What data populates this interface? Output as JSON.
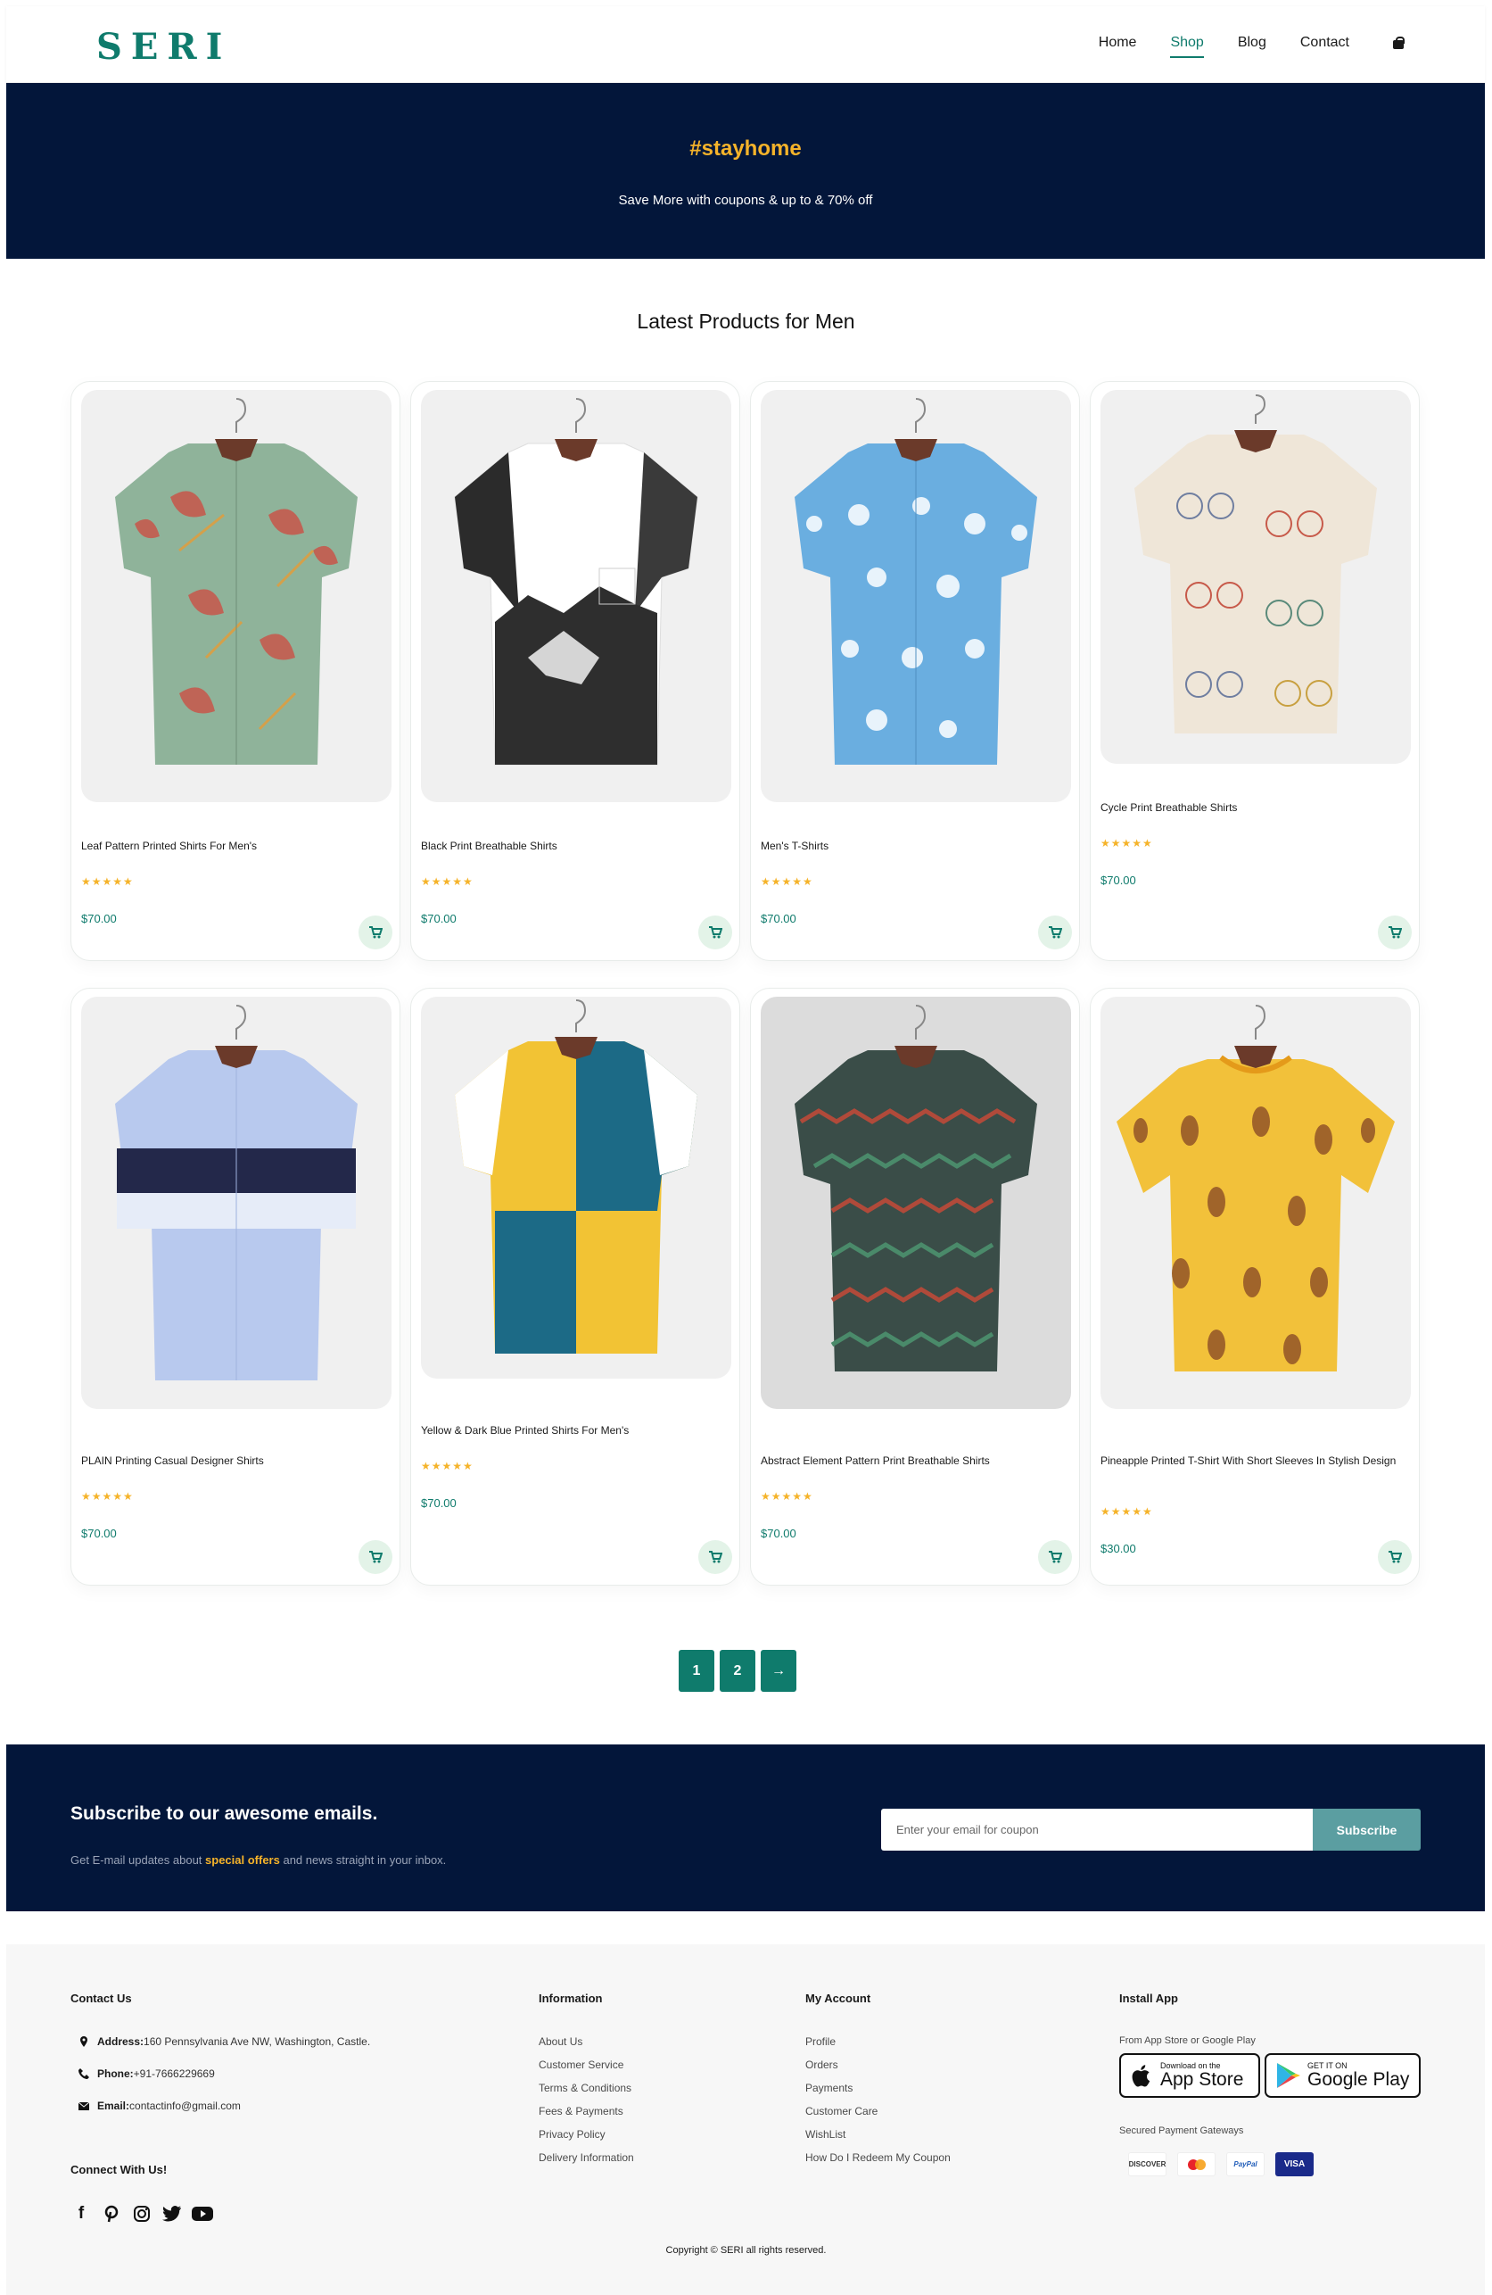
{
  "brand": {
    "logo": "SERI"
  },
  "nav": {
    "items": [
      {
        "label": "Home"
      },
      {
        "label": "Shop"
      },
      {
        "label": "Blog"
      },
      {
        "label": "Contact"
      }
    ],
    "active": "Shop"
  },
  "hero": {
    "tag": "#stayhome",
    "subtitle": "Save More with coupons & up to & 70% off"
  },
  "section_title": "Latest Products for Men",
  "products": [
    {
      "name": "Leaf Pattern Printed Shirts For Men's",
      "stars": "★★★★★",
      "price": "$70.00"
    },
    {
      "name": "Black Print Breathable Shirts",
      "stars": "★★★★★",
      "price": "$70.00"
    },
    {
      "name": "Men's T-Shirts",
      "stars": "★★★★★",
      "price": "$70.00"
    },
    {
      "name": "Cycle Print Breathable Shirts",
      "stars": "★★★★★",
      "price": "$70.00"
    },
    {
      "name": "PLAIN Printing Casual Designer Shirts",
      "stars": "★★★★★",
      "price": "$70.00"
    },
    {
      "name": "Yellow & Dark Blue Printed Shirts For Men's",
      "stars": "★★★★★",
      "price": "$70.00"
    },
    {
      "name": "Abstract Element Pattern Print Breathable Shirts",
      "stars": "★★★★★",
      "price": "$70.00"
    },
    {
      "name": "Pineapple Printed T-Shirt With Short Sleeves In Stylish Design",
      "stars": "★★★★★",
      "price": "$30.00"
    }
  ],
  "pagination": {
    "pages": [
      "1",
      "2"
    ],
    "next": "→"
  },
  "newsletter": {
    "title": "Subscribe to our awesome emails.",
    "text_before": "Get E-mail updates about ",
    "text_highlight": "special offers",
    "text_after": " and news straight in your inbox.",
    "placeholder": "Enter your email for coupon",
    "button": "Subscribe"
  },
  "footer": {
    "contact": {
      "heading": "Contact Us",
      "address_label": "Address:",
      "address": "160 Pennsylvania Ave NW, Washington, Castle.",
      "phone_label": "Phone:",
      "phone": " +91-7666229669",
      "email_label": "Email:",
      "email": " contactinfo@gmail.com"
    },
    "connect": "Connect With Us!",
    "information": {
      "heading": "Information",
      "links": [
        "About Us",
        "Customer Service",
        "Terms & Conditions",
        "Fees & Payments",
        "Privacy Policy",
        "Delivery Information"
      ]
    },
    "account": {
      "heading": "My Account",
      "links": [
        "Profile",
        "Orders",
        "Payments",
        "Customer Care",
        "WishList",
        "How Do I Redeem My Coupon"
      ]
    },
    "app": {
      "heading": "Install App",
      "subtitle": "From App Store or Google Play",
      "appstore_small": "Download on the",
      "appstore_big": "App Store",
      "gplay_small": "GET IT ON",
      "gplay_big": "Google Play",
      "gateways": "Secured Payment Gateways",
      "payments": [
        "DISCOVER",
        "mastercard",
        "PayPal",
        "VISA"
      ]
    },
    "copyright": "Copyright © SERI all rights reserved."
  },
  "colors": {
    "accent": "#0f7b6c",
    "navy": "#03163a",
    "gold": "#f5b32a"
  }
}
